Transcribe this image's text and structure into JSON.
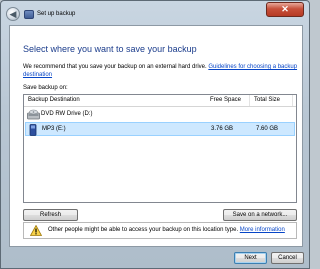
{
  "window": {
    "title": "Set up backup",
    "close_glyph": "✕",
    "back_glyph": "◀"
  },
  "main": {
    "heading": "Select where you want to save your backup",
    "description": "We recommend that you save your backup on an external hard drive.",
    "guideline_link": "Guidelines for choosing a backup destination",
    "save_label": "Save backup on:"
  },
  "table": {
    "columns": [
      "Backup Destination",
      "Free Space",
      "Total Size"
    ],
    "rows": [
      {
        "name": "DVD RW Drive (D:)",
        "free": "",
        "total": "",
        "icon": "dvd-drive-icon",
        "selected": false
      },
      {
        "name": "MP3 (E:)",
        "free": "3.76 GB",
        "total": "7.60 GB",
        "icon": "removable-drive-icon",
        "selected": true
      }
    ]
  },
  "buttons": {
    "refresh": "Refresh",
    "save_network": "Save on a network...",
    "next": "Next",
    "cancel": "Cancel"
  },
  "warning": {
    "text": "Other people might be able to access your backup on this location type.",
    "link": "More information",
    "icon": "warning-icon"
  }
}
